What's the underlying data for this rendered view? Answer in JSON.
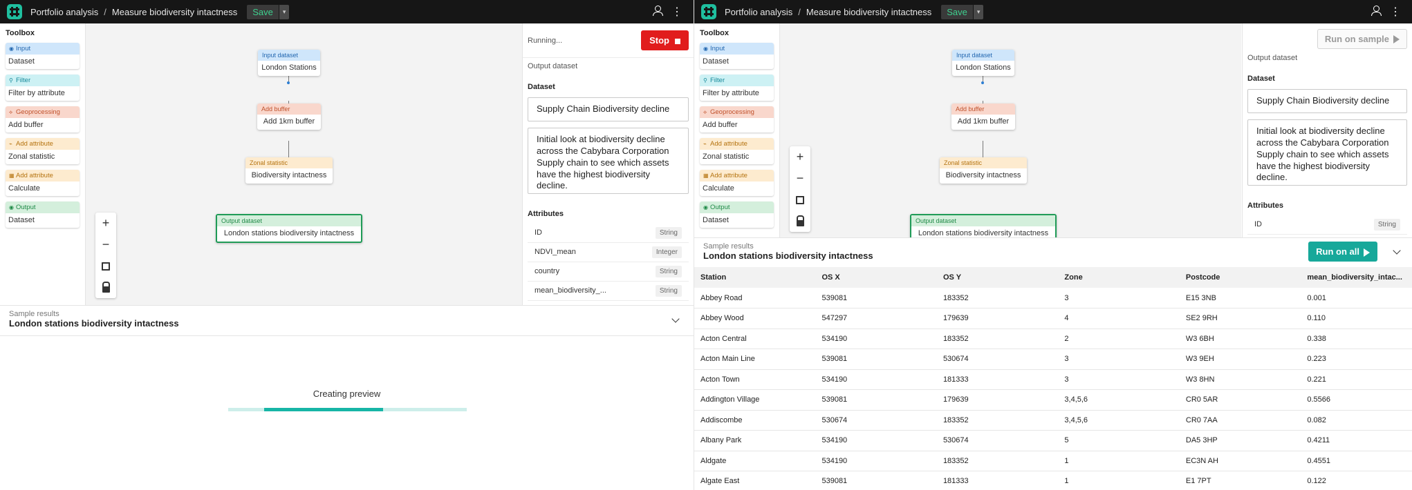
{
  "colors": {
    "input": "#cfe6fb",
    "filter": "#cdf1f4",
    "geoprocessing": "#f9d7cc",
    "attribute": "#fdebcf",
    "output": "#d4efdc",
    "stop": "#e11d1d",
    "run_all": "#17a89a",
    "progress": "#17b5a6"
  },
  "header": {
    "crumb_project": "Portfolio analysis",
    "crumb_separator": "/",
    "crumb_workflow": "Measure biodiversity intactness",
    "save_label": "Save",
    "caret": "▾",
    "user_icon": "user-icon",
    "more_icon": "⋮"
  },
  "toolbox": {
    "title": "Toolbox",
    "items": [
      {
        "tag": "Input",
        "name": "Dataset",
        "icon": "◉"
      },
      {
        "tag": "Filter",
        "name": "Filter by attribute",
        "icon": "⚲"
      },
      {
        "tag": "Geoprocessing",
        "name": "Add buffer",
        "icon": "⟡"
      },
      {
        "tag": "Add attribute",
        "name": "Zonal statistic",
        "icon": "⌁"
      },
      {
        "tag": "Add attribute",
        "name": "Calculate",
        "icon": "▦"
      },
      {
        "tag": "Output",
        "name": "Dataset",
        "icon": "◉"
      }
    ]
  },
  "nodes": [
    {
      "tag": "Input dataset",
      "name": "London Stations"
    },
    {
      "tag": "Add buffer",
      "name": "Add 1km buffer"
    },
    {
      "tag": "Zonal statistic",
      "name": "Biodiversity intactness"
    },
    {
      "tag": "Output dataset",
      "name": "London stations biodiversity intactness"
    }
  ],
  "zoom": {
    "plus": "+",
    "minus": "−"
  },
  "left_panel": {
    "status": "Running...",
    "stop_label": "Stop"
  },
  "right_panel": {
    "run_sample_label": "Run on sample"
  },
  "panel": {
    "section_label": "Output dataset",
    "dataset_label": "Dataset",
    "dataset_name": "Supply Chain Biodiversity decline",
    "description": "Initial look at biodiversity decline across the Cabybara Corporation Supply chain to see which assets have the highest biodiversity decline.",
    "attributes_label": "Attributes",
    "attributes": [
      {
        "name": "ID",
        "type": "String"
      },
      {
        "name": "NDVI_mean",
        "type": "Integer"
      },
      {
        "name": "country",
        "type": "String"
      },
      {
        "name": "mean_biodiversity_...",
        "type": "String"
      }
    ]
  },
  "sample": {
    "label": "Sample results",
    "title": "London stations biodiversity intactness",
    "creating_preview": "Creating preview",
    "progress_start": 0.15,
    "progress_end": 0.65,
    "run_all_label": "Run on all"
  },
  "table": {
    "columns": [
      "Station",
      "OS X",
      "OS Y",
      "Zone",
      "Postcode",
      "mean_biodiversity_intac..."
    ],
    "rows": [
      [
        "Abbey Road",
        "539081",
        "183352",
        "3",
        "E15 3NB",
        "0.001"
      ],
      [
        "Abbey Wood",
        "547297",
        "179639",
        "4",
        "SE2 9RH",
        "0.110"
      ],
      [
        "Acton Central",
        "534190",
        "183352",
        "2",
        "W3 6BH",
        "0.338"
      ],
      [
        "Acton Main Line",
        "539081",
        "530674",
        "3",
        "W3 9EH",
        "0.223"
      ],
      [
        "Acton Town",
        "534190",
        "181333",
        "3",
        "W3 8HN",
        "0.221"
      ],
      [
        "Addington Village",
        "539081",
        "179639",
        "3,4,5,6",
        "CR0 5AR",
        "0.5566"
      ],
      [
        "Addiscombe",
        "530674",
        "183352",
        "3,4,5,6",
        "CR0 7AA",
        "0.082"
      ],
      [
        "Albany Park",
        "534190",
        "530674",
        "5",
        "DA5 3HP",
        "0.4211"
      ],
      [
        "Aldgate",
        "534190",
        "183352",
        "1",
        "EC3N AH",
        "0.4551"
      ],
      [
        "Algate East",
        "539081",
        "181333",
        "1",
        "E1 7PT",
        "0.122"
      ]
    ]
  }
}
